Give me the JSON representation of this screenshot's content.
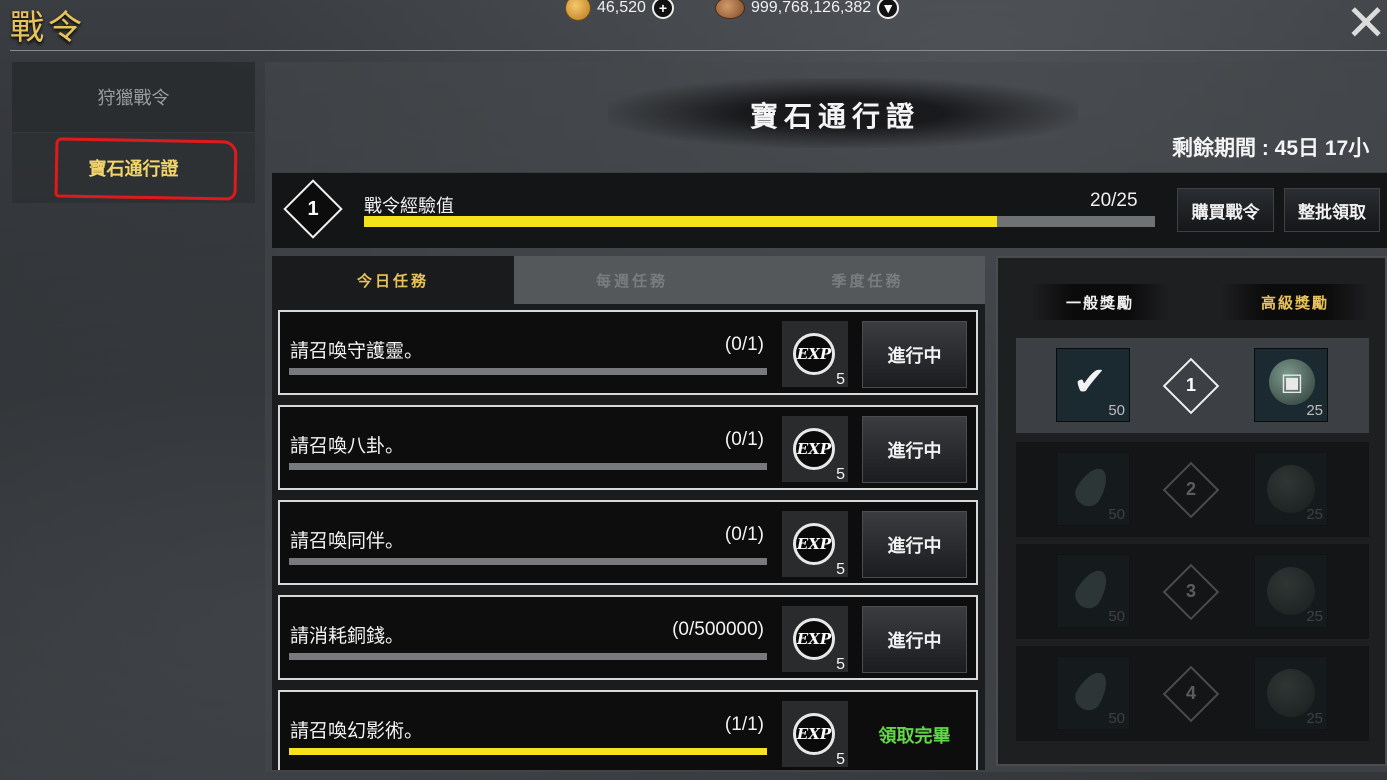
{
  "window": {
    "title": "戰令",
    "close_glyph": "✕"
  },
  "currencies": [
    {
      "name": "coin-icon",
      "value": "46,520",
      "action_glyph": "+"
    },
    {
      "name": "copper-icon",
      "value": "999,768,126,382",
      "action_glyph": "▼"
    }
  ],
  "sidebar": {
    "items": [
      {
        "label": "狩獵戰令",
        "active": false
      },
      {
        "label": "寶石通行證",
        "active": true
      }
    ]
  },
  "main": {
    "title": "寶石通行證",
    "remaining": "剩餘期間 : 45日 17小"
  },
  "exp": {
    "level": "1",
    "label": "戰令經驗值",
    "value_text": "20/25",
    "progress": 0.8
  },
  "buttons": {
    "buy": "購買戰令",
    "claim_all": "整批領取"
  },
  "quest_tabs": [
    {
      "label": "今日任務",
      "active": true
    },
    {
      "label": "每週任務",
      "active": false
    },
    {
      "label": "季度任務",
      "active": false
    }
  ],
  "quests": [
    {
      "text": "請召喚守護靈。",
      "count": "(0/1)",
      "progress": 0,
      "exp": "5",
      "status": "進行中",
      "completed": false
    },
    {
      "text": "請召喚八卦。",
      "count": "(0/1)",
      "progress": 0,
      "exp": "5",
      "status": "進行中",
      "completed": false
    },
    {
      "text": "請召喚同伴。",
      "count": "(0/1)",
      "progress": 0,
      "exp": "5",
      "status": "進行中",
      "completed": false
    },
    {
      "text": "請消耗銅錢。",
      "count": "(0/500000)",
      "progress": 0,
      "exp": "5",
      "status": "進行中",
      "completed": false
    },
    {
      "text": "請召喚幻影術。",
      "count": "(1/1)",
      "progress": 1,
      "exp": "5",
      "status": "領取完畢",
      "completed": true
    }
  ],
  "exp_badge_text": "EXP",
  "rewards": {
    "normal_label": "一般獎勵",
    "premium_label": "高級獎勵",
    "rows": [
      {
        "level": "1",
        "normal_count": "50",
        "premium_count": "25",
        "normal_icon": "check-icon",
        "premium_icon": "lock-icon",
        "unlocked": true
      },
      {
        "level": "2",
        "normal_count": "50",
        "premium_count": "25",
        "normal_icon": "leaf-icon",
        "premium_icon": "orb-icon",
        "unlocked": false
      },
      {
        "level": "3",
        "normal_count": "50",
        "premium_count": "25",
        "normal_icon": "leaf-icon",
        "premium_icon": "orb-icon",
        "unlocked": false
      },
      {
        "level": "4",
        "normal_count": "50",
        "premium_count": "25",
        "normal_icon": "leaf-icon",
        "premium_icon": "orb-icon",
        "unlocked": false
      }
    ]
  },
  "colors": {
    "accent_gold": "#e8c35a",
    "progress_yellow": "#f4e21a",
    "completed_green": "#63d64a",
    "annotation_red": "#e01a1a"
  }
}
